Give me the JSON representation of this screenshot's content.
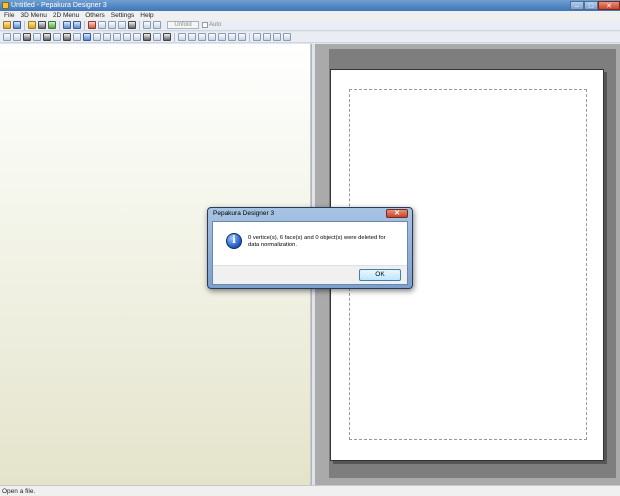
{
  "window": {
    "title": "Untitled - Pepakura Designer 3",
    "controls": {
      "minimize": "–",
      "maximize": "□",
      "close": "✕"
    }
  },
  "menu": {
    "items": [
      "File",
      "3D Menu",
      "2D Menu",
      "Others",
      "Settings",
      "Help"
    ]
  },
  "toolbar1": {
    "unfold_label": "Unfold",
    "auto_label": "Auto"
  },
  "statusbar": {
    "text": "Open a file."
  },
  "dialog": {
    "title": "Pepakura Designer 3",
    "message": "0 vertice(s), 6 face(s) and 0 object(s) were deleted for data normalization.",
    "ok_label": "OK",
    "close_glyph": "✕",
    "icon": "info-icon",
    "icon_glyph": "i"
  },
  "colors": {
    "titlebar": "#3f76b8",
    "view2d_background": "#aaaaaa",
    "paper_border": "#333333"
  }
}
